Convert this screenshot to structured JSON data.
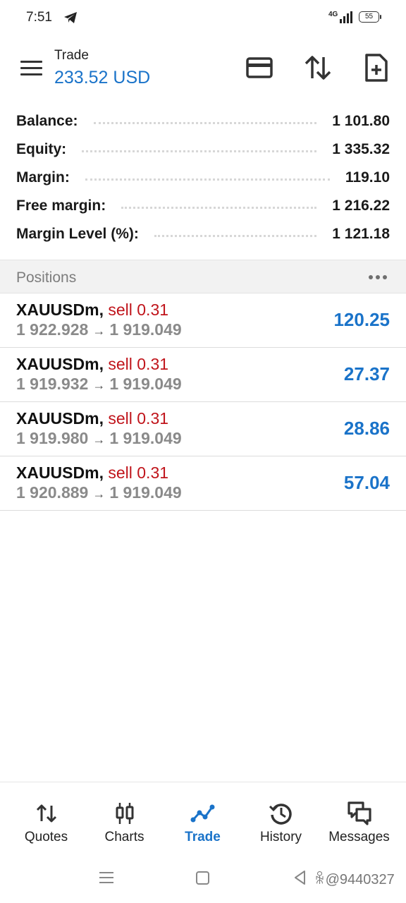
{
  "status_bar": {
    "time": "7:51",
    "network": "4G",
    "battery": "55"
  },
  "header": {
    "title": "Trade",
    "subtitle": "233.52 USD"
  },
  "summary": [
    {
      "label": "Balance:",
      "value": "1 101.80"
    },
    {
      "label": "Equity:",
      "value": "1 335.32"
    },
    {
      "label": "Margin:",
      "value": "119.10"
    },
    {
      "label": "Free margin:",
      "value": "1 216.22"
    },
    {
      "label": "Margin Level (%):",
      "value": "1 121.18"
    }
  ],
  "positions": {
    "title": "Positions",
    "items": [
      {
        "symbol": "XAUUSDm",
        "side": "sell 0.31",
        "open_price": "1 922.928",
        "current_price": "1 919.049",
        "profit": "120.25"
      },
      {
        "symbol": "XAUUSDm",
        "side": "sell 0.31",
        "open_price": "1 919.932",
        "current_price": "1 919.049",
        "profit": "27.37"
      },
      {
        "symbol": "XAUUSDm",
        "side": "sell 0.31",
        "open_price": "1 919.980",
        "current_price": "1 919.049",
        "profit": "28.86"
      },
      {
        "symbol": "XAUUSDm",
        "side": "sell 0.31",
        "open_price": "1 920.889",
        "current_price": "1 919.049",
        "profit": "57.04"
      }
    ]
  },
  "bottom_nav": [
    {
      "label": "Quotes",
      "icon": "quotes-icon"
    },
    {
      "label": "Charts",
      "icon": "charts-icon"
    },
    {
      "label": "Trade",
      "icon": "trade-icon",
      "active": true
    },
    {
      "label": "History",
      "icon": "history-icon"
    },
    {
      "label": "Messages",
      "icon": "messages-icon"
    }
  ],
  "watermark": "ꆜ@9440327",
  "colors": {
    "accent": "#1a73c9",
    "sell": "#c0141b",
    "muted": "#8a8a8a"
  }
}
